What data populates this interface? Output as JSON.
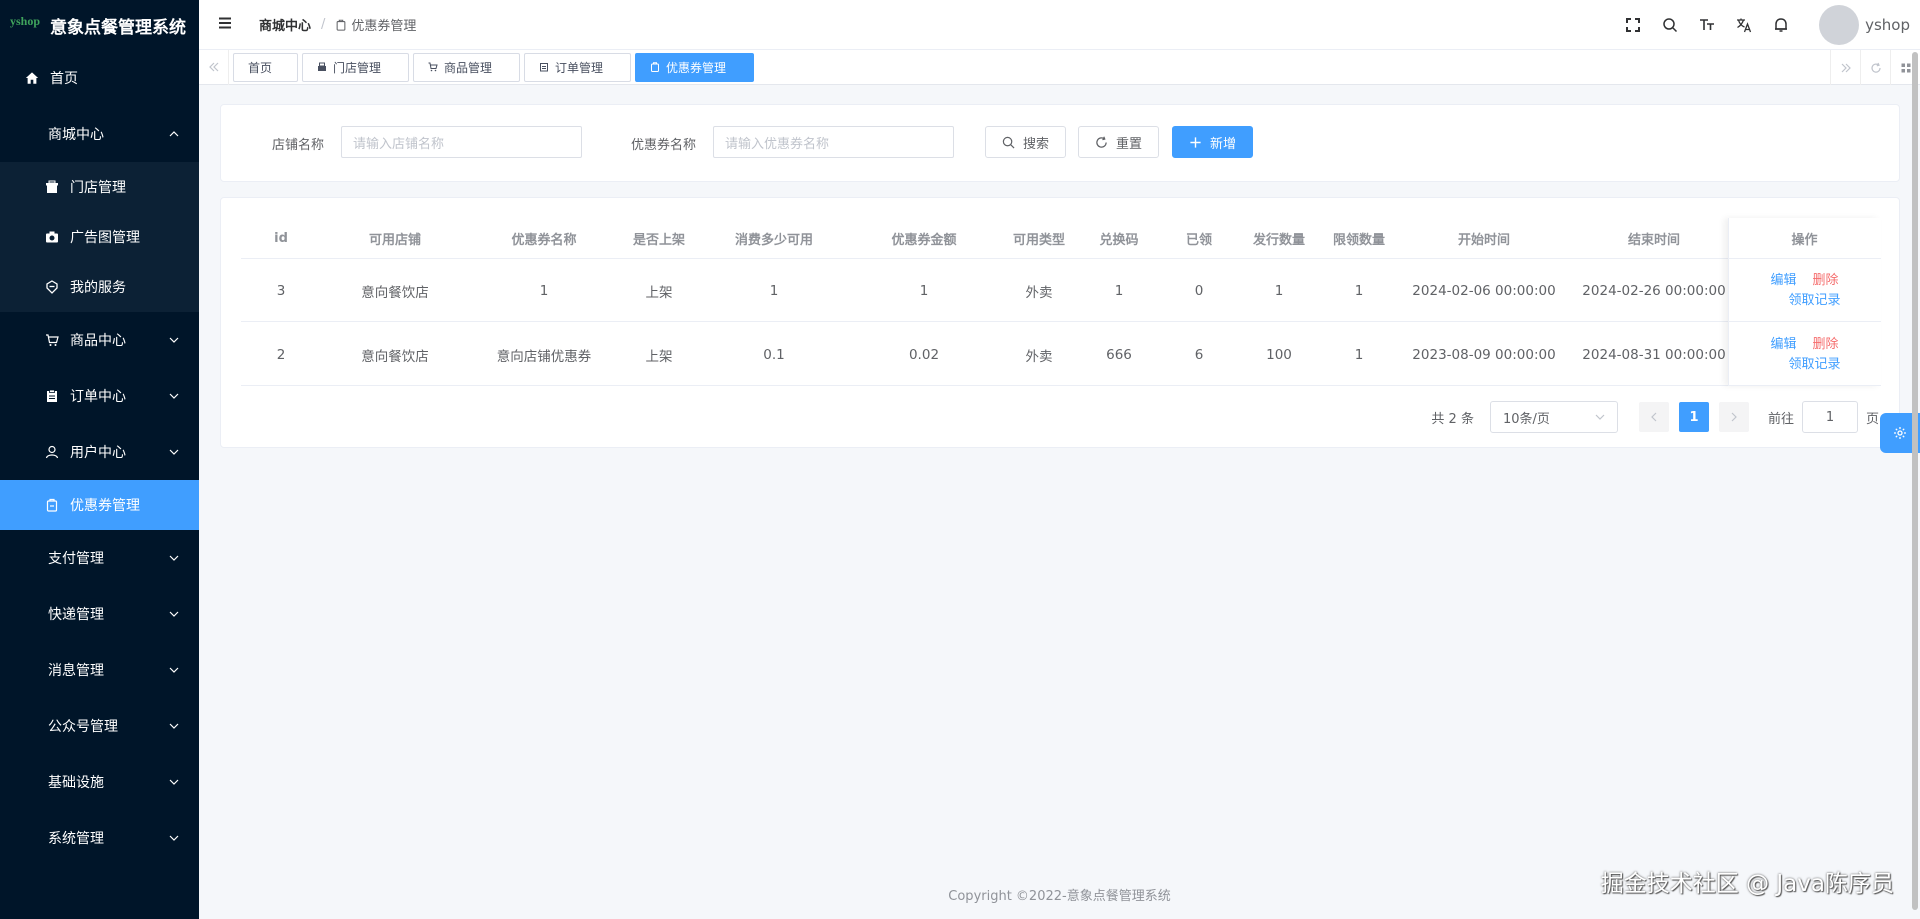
{
  "app": {
    "logo_mark": "yshop",
    "title": "意象点餐管理系统"
  },
  "sidebar": {
    "home": "首页",
    "mall_center": "商城中心",
    "store_mgmt": "门店管理",
    "ad_mgmt": "广告图管理",
    "my_services": "我的服务",
    "product_center": "商品中心",
    "order_center": "订单中心",
    "user_center": "用户中心",
    "coupon_mgmt": "优惠券管理",
    "payment_mgmt": "支付管理",
    "express_mgmt": "快递管理",
    "message_mgmt": "消息管理",
    "official_account_mgmt": "公众号管理",
    "base_settings": "基础设施",
    "system_mgmt": "系统管理"
  },
  "header": {
    "breadcrumb_parent": "商城中心",
    "breadcrumb_separator": "/",
    "breadcrumb_current": "优惠券管理",
    "username": "yshop"
  },
  "tags": [
    "首页",
    "门店管理",
    "商品管理",
    "订单管理",
    "优惠券管理"
  ],
  "search": {
    "shop_label": "店铺名称",
    "shop_placeholder": "请输入店铺名称",
    "coupon_label": "优惠券名称",
    "coupon_placeholder": "请输入优惠券名称",
    "search_btn": "搜索",
    "reset_btn": "重置",
    "add_btn": "新增"
  },
  "table": {
    "headers": [
      "id",
      "可用店铺",
      "优惠券名称",
      "是否上架",
      "消费多少可用",
      "优惠券金额",
      "可用类型",
      "兑换码",
      "已领",
      "发行数量",
      "限领数量",
      "开始时间",
      "结束时间",
      "操作"
    ],
    "rows": [
      [
        "3",
        "意向餐饮店",
        "1",
        "上架",
        "1",
        "1",
        "外卖",
        "1",
        "0",
        "1",
        "1",
        "2024-02-06 00:00:00",
        "2024-02-26 00:00:00"
      ],
      [
        "2",
        "意向餐饮店",
        "意向店铺优惠券",
        "上架",
        "0.1",
        "0.02",
        "外卖",
        "666",
        "6",
        "100",
        "1",
        "2023-08-09 00:00:00",
        "2024-08-31 00:00:00"
      ]
    ],
    "op_edit": "编辑",
    "op_delete": "删除",
    "op_records": "领取记录"
  },
  "pagination": {
    "total_text": "共 2 条",
    "page_size": "10条/页",
    "current_page": "1",
    "goto_label": "前往",
    "goto_value": "1",
    "page_suffix": "页"
  },
  "footer": {
    "copyright": "Copyright ©2022-意象点餐管理系统"
  },
  "watermark": "掘金技术社区 @ Java陈序员",
  "colors": {
    "sidebar_bg": "#001529",
    "submenu_bg": "#0c2135",
    "accent": "#409eff",
    "danger": "#f56c6c"
  }
}
